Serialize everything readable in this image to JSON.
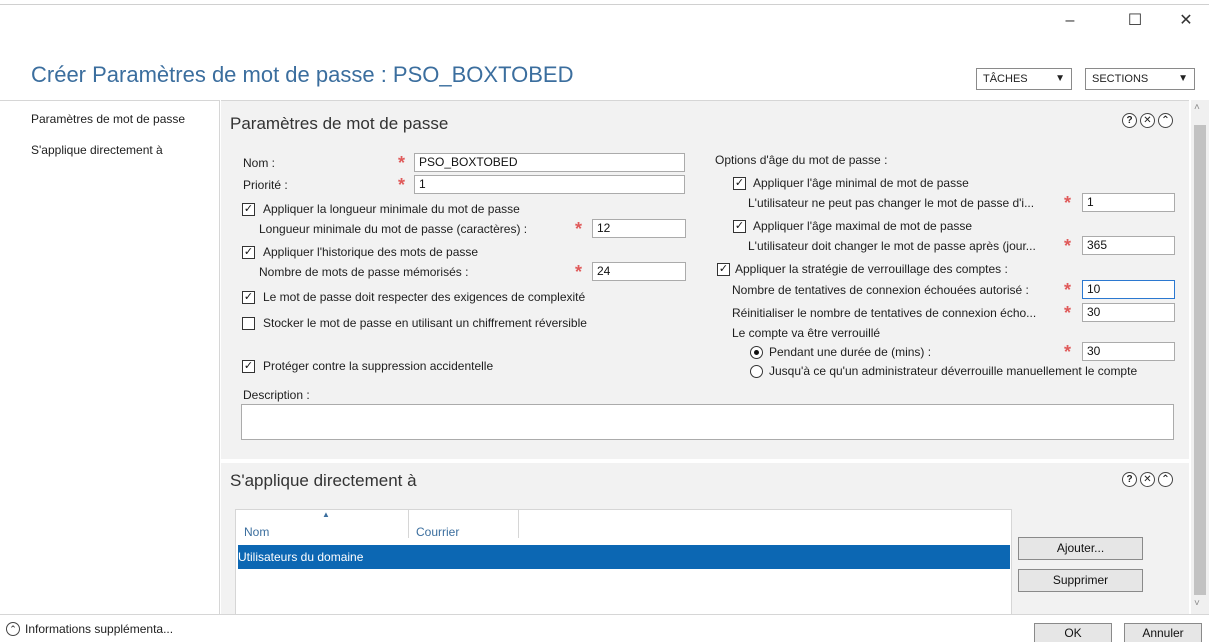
{
  "window": {
    "minimize": "–",
    "maximize": "☐",
    "close": "✕"
  },
  "header": {
    "title": "Créer Paramètres de mot de passe : PSO_BOXTOBED",
    "tasks_label": "TÂCHES",
    "sections_label": "SECTIONS",
    "caret": "▼"
  },
  "nav": {
    "items": [
      "Paramètres de mot de passe",
      "S'applique directement à"
    ]
  },
  "password_section": {
    "title": "Paramètres de mot de passe",
    "icons": {
      "help": "?",
      "close": "✕",
      "collapse": "⌃"
    },
    "name_label": "Nom :",
    "name_value": "PSO_BOXTOBED",
    "priority_label": "Priorité :",
    "priority_value": "1",
    "min_length_check": "Appliquer la longueur minimale du mot de passe",
    "min_length_label": "Longueur minimale du mot de passe (caractères) :",
    "min_length_value": "12",
    "history_check": "Appliquer l'historique des mots de passe",
    "history_label": "Nombre de mots de passe mémorisés :",
    "history_value": "24",
    "complexity_check": "Le mot de passe doit respecter des exigences de complexité",
    "reversible_check": "Stocker le mot de passe en utilisant un chiffrement réversible",
    "protect_check": "Protéger contre la suppression accidentelle",
    "description_label": "Description :",
    "description_value": "",
    "age_options_label": "Options d'âge du mot de passe :",
    "min_age_check": "Appliquer l'âge minimal de mot de passe",
    "min_age_label": "L'utilisateur ne peut pas changer le mot de passe d'i...",
    "min_age_value": "1",
    "max_age_check": "Appliquer l'âge maximal de mot de passe",
    "max_age_label": "L'utilisateur doit changer le mot de passe après (jour...",
    "max_age_value": "365",
    "lockout_check": "Appliquer la stratégie de verrouillage des comptes :",
    "failed_label": "Nombre de tentatives de connexion échouées autorisé :",
    "failed_value": "10",
    "reset_label": "Réinitialiser le nombre de tentatives de connexion écho...",
    "reset_value": "30",
    "locked_label": "Le compte va être verrouillé",
    "duration_radio": "Pendant une durée de (mins) :",
    "duration_value": "30",
    "admin_radio": "Jusqu'à ce qu'un administrateur déverrouille manuellement le compte",
    "check_mark": "✓"
  },
  "applies_section": {
    "title": "S'applique directement à",
    "columns": [
      "Nom",
      "Courrier"
    ],
    "sort_indicator": "▲",
    "rows": [
      {
        "name": "Utilisateurs du domaine",
        "mail": ""
      }
    ],
    "add_button": "Ajouter...",
    "remove_button": "Supprimer"
  },
  "footer": {
    "more_info": "Informations supplémenta...",
    "ok": "OK",
    "cancel": "Annuler"
  }
}
